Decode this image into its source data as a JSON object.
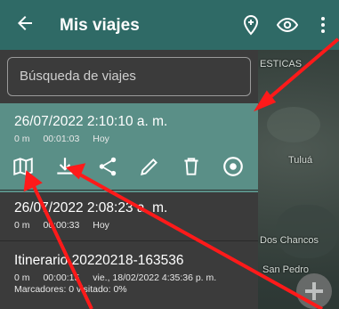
{
  "appbar": {
    "title": "Mis viajes"
  },
  "search": {
    "placeholder": "Búsqueda de viajes"
  },
  "trips": [
    {
      "title": "26/07/2022 2:10:10 a. m.",
      "distance": "0 m",
      "duration": "00:01:03",
      "when": "Hoy"
    },
    {
      "title": "26/07/2022 2:08:23 a. m.",
      "distance": "0 m",
      "duration": "00:00:33",
      "when": "Hoy"
    },
    {
      "title": "Itinerario 20220218-163536",
      "distance": "0 m",
      "duration": "00:00:15",
      "when": "vie., 18/02/2022 4:35:36 p. m.",
      "markers": "Marcadores: 0 visitado: 0%"
    }
  ],
  "map": {
    "labels": [
      "ESTICAS",
      "Tuluá",
      "Dos Chancos",
      "San Pedro"
    ]
  },
  "icons": [
    "back-arrow-icon",
    "location-add-icon",
    "eye-icon",
    "more-vert-icon",
    "map-icon",
    "download-icon",
    "share-icon",
    "edit-icon",
    "delete-icon",
    "record-icon",
    "plus-icon"
  ],
  "colors": {
    "appbar": "#2f6a66",
    "selected": "#5a8f87",
    "panel": "#3b3b3b",
    "annotation_arrow": "#ff1a1a"
  }
}
